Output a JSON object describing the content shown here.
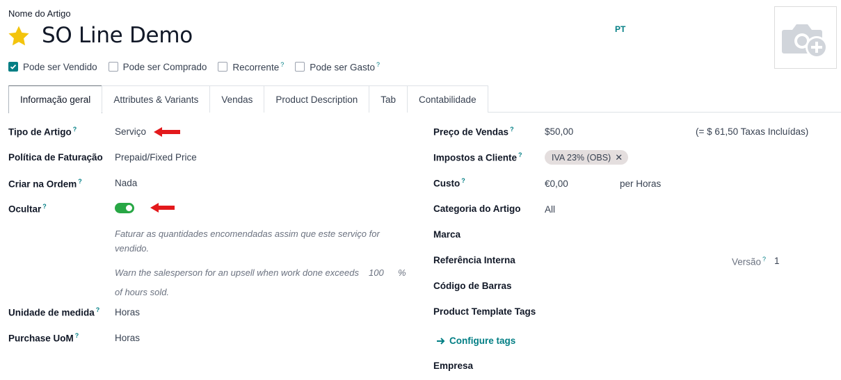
{
  "header": {
    "name_label": "Nome do Artigo",
    "title": "SO Line Demo",
    "language": "PT",
    "favorite_icon": "star-icon",
    "photo_icon": "camera-add-icon"
  },
  "checkboxes": [
    {
      "label": "Pode ser Vendido",
      "checked": true,
      "help": ""
    },
    {
      "label": "Pode ser Comprado",
      "checked": false,
      "help": ""
    },
    {
      "label": "Recorrente",
      "checked": false,
      "help": "?"
    },
    {
      "label": "Pode ser Gasto",
      "checked": false,
      "help": "?"
    }
  ],
  "tabs": [
    {
      "label": "Informação geral",
      "active": true
    },
    {
      "label": "Attributes & Variants",
      "active": false
    },
    {
      "label": "Vendas",
      "active": false
    },
    {
      "label": "Product Description",
      "active": false
    },
    {
      "label": "Tab",
      "active": false
    },
    {
      "label": "Contabilidade",
      "active": false
    }
  ],
  "left": {
    "tipo_label": "Tipo de Artigo",
    "tipo_value": "Serviço",
    "politica_label": "Política de Faturação",
    "politica_value": "Prepaid/Fixed Price",
    "criar_label": "Criar na Ordem",
    "criar_value": "Nada",
    "ocultar_label": "Ocultar",
    "ocultar_on": true,
    "help_invoice": "Faturar as quantidades encomendadas assim que este serviço for vendido.",
    "help_upsell_1": "Warn the salesperson for an upsell when work done exceeds",
    "upsell_value": "100",
    "upsell_unit": "%",
    "help_upsell_2": "of hours sold.",
    "uom_label": "Unidade de medida",
    "uom_value": "Horas",
    "puom_label": "Purchase UoM",
    "puom_value": "Horas"
  },
  "right": {
    "preco_label": "Preço de Vendas",
    "preco_value": "$50,00",
    "preco_taxes": "(= $ 61,50 Taxas Incluídas)",
    "impostos_label": "Impostos a Cliente",
    "impostos_tag": "IVA 23% (OBS)",
    "custo_label": "Custo",
    "custo_value": "€0,00",
    "custo_unit": "per Horas",
    "categoria_label": "Categoria do Artigo",
    "categoria_value": "All",
    "marca_label": "Marca",
    "ref_label": "Referência Interna",
    "versao_label": "Versão",
    "versao_value": "1",
    "barras_label": "Código de Barras",
    "tags_label": "Product Template Tags",
    "configure_tags": "Configure tags",
    "empresa_label": "Empresa"
  },
  "help_mark": "?",
  "colors": {
    "accent": "#017e84",
    "toggle": "#28a745",
    "arrow": "#e3191c",
    "star": "#f3c40d"
  }
}
